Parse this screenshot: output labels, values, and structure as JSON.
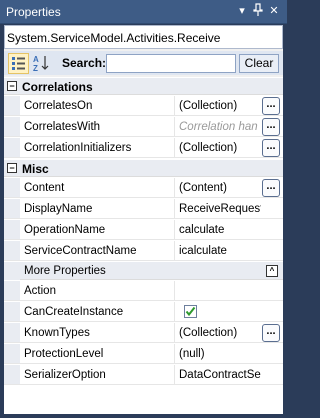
{
  "window": {
    "title": "Properties",
    "dropdown_glyph": "▾",
    "pin_glyph": "ꟷ",
    "close_glyph": "✕"
  },
  "object_selector": "System.ServiceModel.Activities.Receive",
  "toolbar": {
    "categorized_icon": "categorized-icon",
    "alphabetical_icon": "alphabetical-icon",
    "search_label": "Search:",
    "search_value": "",
    "clear_label": "Clear"
  },
  "categories": {
    "correlations": {
      "label": "Correlations",
      "toggle": "−"
    },
    "misc": {
      "label": "Misc",
      "toggle": "−"
    }
  },
  "correlations_props": [
    {
      "name": "CorrelatesOn",
      "value": "(Collection)",
      "ellipsis": "..."
    },
    {
      "name": "CorrelatesWith",
      "value": "Correlation han",
      "ellipsis": "..."
    },
    {
      "name": "CorrelationInitializers",
      "value": "(Collection)",
      "ellipsis": "..."
    }
  ],
  "misc_props": [
    {
      "name": "Content",
      "value": "(Content)",
      "ellipsis": "..."
    },
    {
      "name": "DisplayName",
      "value": "ReceiveRequest"
    },
    {
      "name": "OperationName",
      "value": "calculate"
    },
    {
      "name": "ServiceContractName",
      "value": "icalculate"
    }
  ],
  "more_properties": {
    "label": "More Properties",
    "toggle": "^"
  },
  "more_props": [
    {
      "name": "Action",
      "value": ""
    },
    {
      "name": "CanCreateInstance",
      "value": "true"
    },
    {
      "name": "KnownTypes",
      "value": "(Collection)",
      "ellipsis": "..."
    },
    {
      "name": "ProtectionLevel",
      "value": "(null)"
    },
    {
      "name": "SerializerOption",
      "value": "DataContractSeri"
    }
  ],
  "colors": {
    "titlebar": "#3e5c86",
    "frame": "#2b3c59",
    "checkbox_check": "#2e9a2e"
  }
}
